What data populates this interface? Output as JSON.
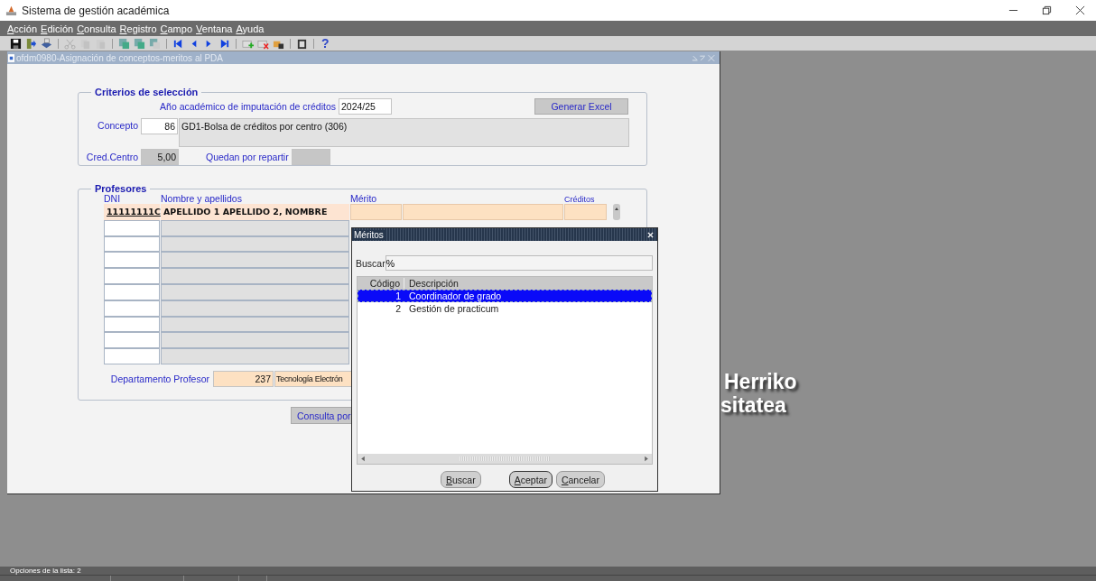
{
  "window": {
    "title": "Sistema de gestión académica"
  },
  "menu": [
    "Acción",
    "Edición",
    "Consulta",
    "Registro",
    "Campo",
    "Ventana",
    "Ayuda"
  ],
  "toolbar": {
    "help": "?"
  },
  "form": {
    "title": "ofdm0980-Asignación de conceptos-meritos al PDA",
    "criteria": {
      "title": "Criterios de selección",
      "year_label": "Año académico de imputación de créditos",
      "year": "2024/25",
      "excel_button": "Generar Excel",
      "concept_label": "Concepto",
      "concept_code": "86",
      "concept_description": "GD1-Bolsa de créditos por centro (306)",
      "credits_label": "Cred.Centro",
      "credits": "5,00",
      "remaining_label": "Quedan por repartir"
    },
    "teachers": {
      "title": "Profesores",
      "columns": [
        "DNI",
        "Nombre y apellidos",
        "Mérito",
        "Créditos"
      ],
      "rows": [
        {
          "dni": "11111111C",
          "name": "APELLIDO 1 APELLIDO 2, NOMBRE",
          "selected": true
        },
        {
          "selected": false
        },
        {
          "selected": false
        },
        {
          "selected": false
        },
        {
          "selected": false
        },
        {
          "selected": false
        },
        {
          "selected": false
        },
        {
          "selected": false
        },
        {
          "selected": false
        },
        {
          "selected": false
        }
      ],
      "department_label": "Departamento Profesor",
      "department_code": "237",
      "department_name": "Tecnología Electrón"
    },
    "query_button": "Consulta por"
  },
  "background_text": [
    "Herriko",
    "sitatea"
  ],
  "dialog": {
    "title": "Méritos",
    "search_label": "Buscar",
    "search_value": "%",
    "columns": [
      "Código",
      "Descripción"
    ],
    "rows": [
      {
        "code": "1",
        "description": "Coordinador de grado",
        "selected": true
      },
      {
        "code": "2",
        "description": "Gestión de practicum",
        "selected": false
      }
    ],
    "buttons": [
      {
        "label": "Buscar",
        "focused": false
      },
      {
        "label": "Aceptar",
        "focused": true
      },
      {
        "label": "Cancelar",
        "focused": false
      }
    ]
  },
  "status_bar": {
    "message": "Opciones de la lista: 2"
  }
}
